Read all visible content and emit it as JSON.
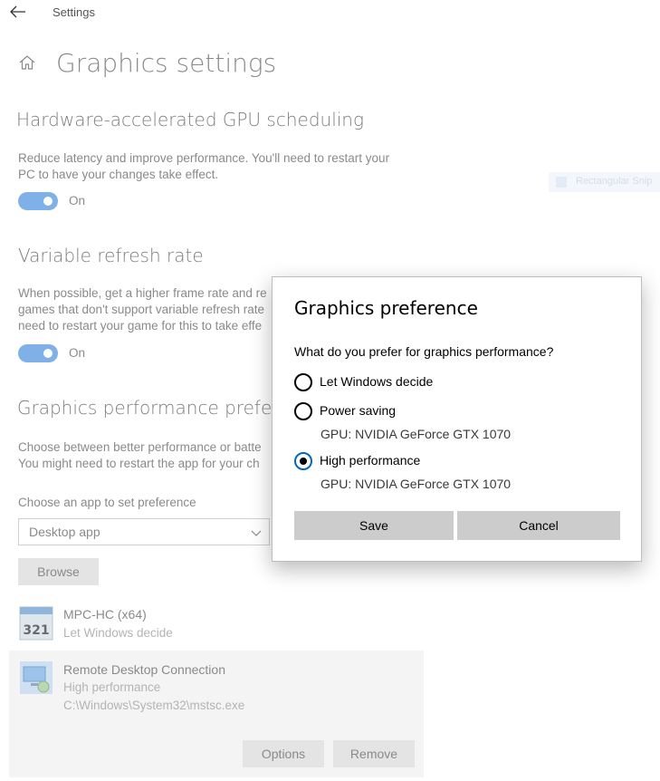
{
  "window": {
    "title": "Settings"
  },
  "page": {
    "title": "Graphics settings",
    "gpu_scheduling": {
      "heading": "Hardware-accelerated GPU scheduling",
      "description_line1": "Reduce latency and improve performance. You'll need to restart your",
      "description_line2": "PC to have your changes take effect.",
      "toggle_state": "On"
    },
    "vrr": {
      "heading": "Variable refresh rate",
      "description_line1": "When possible, get a higher frame rate and re",
      "description_line2": "games that don't support variable refresh rate",
      "description_line3": "need to restart your game for this to take effe",
      "toggle_state": "On"
    },
    "gpp": {
      "heading": "Graphics performance preferenc",
      "description_line1": "Choose between better performance or batte",
      "description_line2": "You might need to restart the app for your ch",
      "choose_label": "Choose an app to set preference",
      "dropdown_value": "Desktop app",
      "browse_label": "Browse"
    },
    "apps": [
      {
        "name": "MPC-HC (x64)",
        "preference": "Let Windows decide",
        "path": ""
      },
      {
        "name": "Remote Desktop Connection",
        "preference": "High performance",
        "path": "C:\\Windows\\System32\\mstsc.exe"
      }
    ],
    "app_buttons": {
      "options": "Options",
      "remove": "Remove"
    },
    "faint_widget_label": "Rectangular Snip"
  },
  "dialog": {
    "title": "Graphics preference",
    "question": "What do you prefer for graphics performance?",
    "options": [
      {
        "label": "Let Windows decide",
        "gpu": "",
        "selected": false
      },
      {
        "label": "Power saving",
        "gpu": "GPU: NVIDIA GeForce GTX 1070",
        "selected": false
      },
      {
        "label": "High performance",
        "gpu": "GPU: NVIDIA GeForce GTX 1070",
        "selected": true
      }
    ],
    "save_label": "Save",
    "cancel_label": "Cancel"
  },
  "colors": {
    "accent": "#0067c0",
    "toggle_on_dimmed": "#7fb0e8",
    "button_gray": "#cccccc"
  }
}
